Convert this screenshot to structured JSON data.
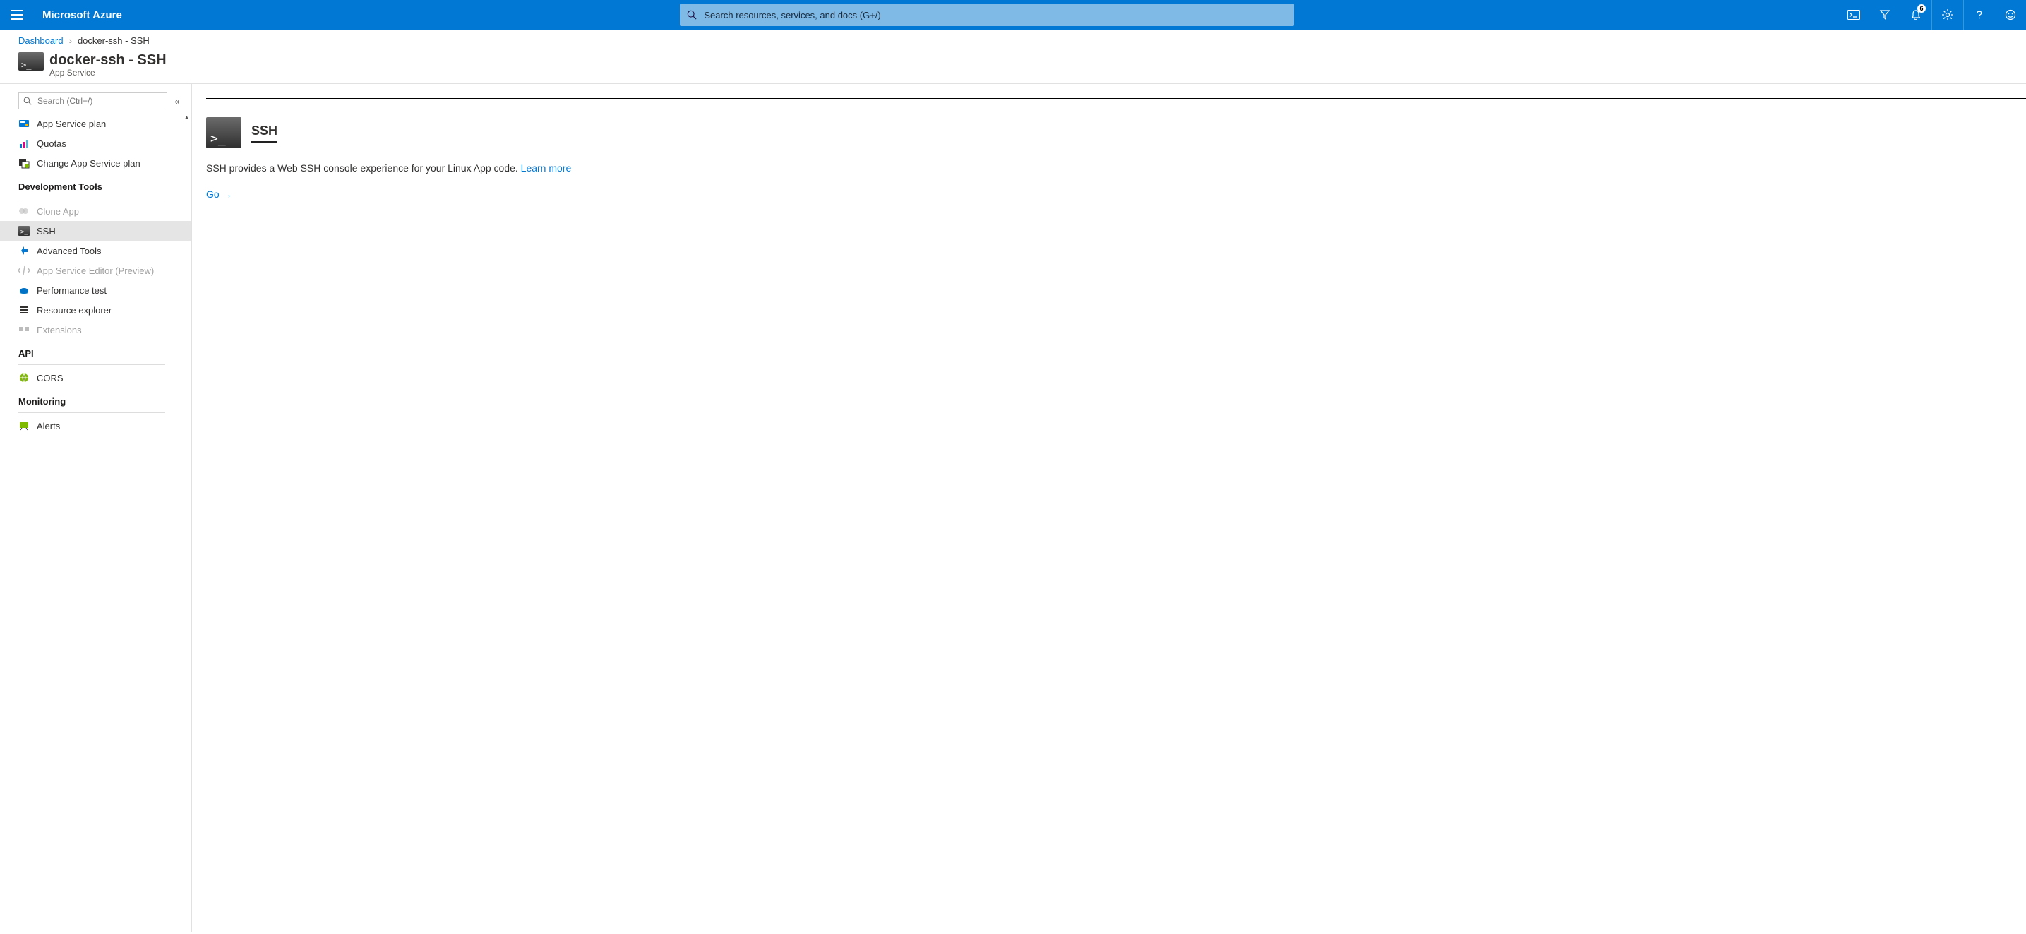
{
  "brand": "Microsoft Azure",
  "search_placeholder": "Search resources, services, and docs (G+/)",
  "notification_count": "6",
  "breadcrumb": {
    "root": "Dashboard",
    "current": "docker-ssh - SSH"
  },
  "header": {
    "title": "docker-ssh - SSH",
    "subtitle": "App Service"
  },
  "sidebar": {
    "search_placeholder": "Search (Ctrl+/)",
    "groups": [
      {
        "items": [
          {
            "label": "App Service plan",
            "icon": "plan"
          },
          {
            "label": "Quotas",
            "icon": "quotas"
          },
          {
            "label": "Change App Service plan",
            "icon": "change"
          }
        ]
      },
      {
        "title": "Development Tools",
        "items": [
          {
            "label": "Clone App",
            "icon": "clone",
            "disabled": true
          },
          {
            "label": "SSH",
            "icon": "terminal",
            "selected": true
          },
          {
            "label": "Advanced Tools",
            "icon": "kudu"
          },
          {
            "label": "App Service Editor (Preview)",
            "icon": "editor",
            "disabled": true
          },
          {
            "label": "Performance test",
            "icon": "perf"
          },
          {
            "label": "Resource explorer",
            "icon": "explorer"
          },
          {
            "label": "Extensions",
            "icon": "ext",
            "disabled": true
          }
        ]
      },
      {
        "title": "API",
        "items": [
          {
            "label": "CORS",
            "icon": "cors"
          }
        ]
      },
      {
        "title": "Monitoring",
        "items": [
          {
            "label": "Alerts",
            "icon": "alerts"
          }
        ]
      }
    ]
  },
  "main": {
    "title": "SSH",
    "description": "SSH provides a Web SSH console experience for your Linux App code.",
    "learn_more": "Learn more",
    "go_label": "Go"
  },
  "icons": {
    "search_glyph": "⌕",
    "prompt": ">_",
    "collapse": "«",
    "arrow_right": "→",
    "chevron_up": "▴",
    "breadcrumb_sep": "›"
  }
}
